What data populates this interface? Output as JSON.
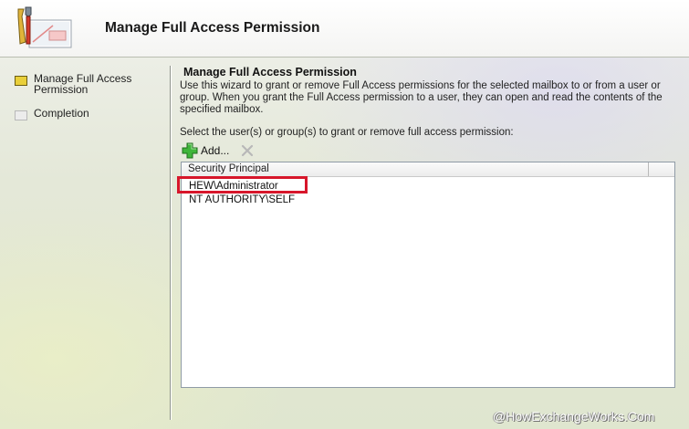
{
  "header": {
    "title": "Manage Full Access Permission",
    "icon": "wizard-icon"
  },
  "nav": {
    "items": [
      {
        "label": "Manage Full Access Permission",
        "state": "current",
        "icon": "yellow-bullet-icon"
      },
      {
        "label": "Completion",
        "state": "pending",
        "icon": "gray-bullet-icon"
      }
    ]
  },
  "content": {
    "title": "Manage Full Access Permission",
    "description": "Use this wizard to grant or remove Full Access permissions for the selected mailbox to or from a user or group. When you grant the Full Access permission to a user, they can open and read the contents of the specified mailbox.",
    "select_label": "Select the user(s) or group(s) to grant or remove full access permission:",
    "toolbar": {
      "add_label": "Add...",
      "add_icon": "green-plus-icon",
      "remove_icon": "remove-x-icon"
    },
    "list": {
      "column_header": "Security Principal",
      "rows": [
        "HEW\\Administrator",
        "NT AUTHORITY\\SELF"
      ]
    }
  },
  "colors": {
    "highlight": "#d7162b",
    "nav_current": "#e9cf3a"
  },
  "watermark": "@HowExchangeWorks.Com"
}
